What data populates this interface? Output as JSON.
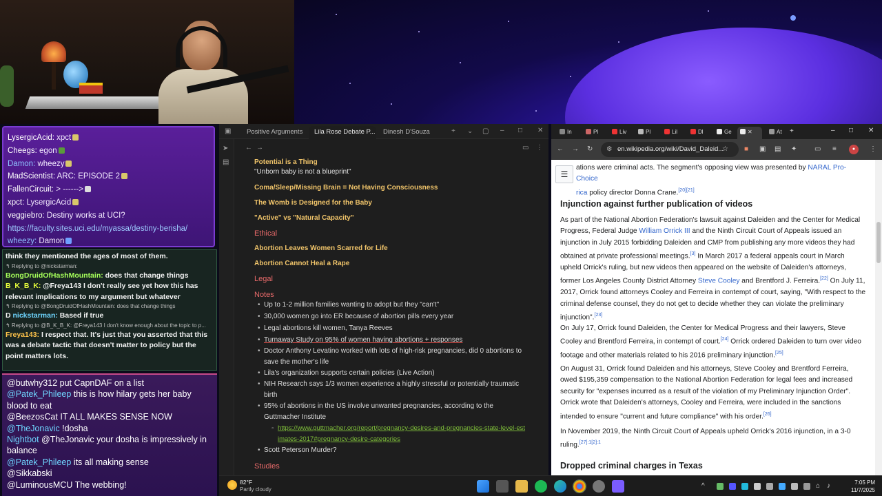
{
  "chat_top": [
    {
      "user": "LysergicAcid:",
      "text": " xpct",
      "blue": false
    },
    {
      "user": "Cheegs:",
      "text": " egon",
      "blue": false
    },
    {
      "user": "Damon:",
      "text": " wheezy",
      "blue": true
    },
    {
      "user": "MadScientist:",
      "text": " ARC: EPISODE 2",
      "blue": false
    },
    {
      "user": "FallenCircuit:",
      "text": " > ------>",
      "blue": false
    },
    {
      "user": "xpct:",
      "text": " LysergicAcid",
      "blue": false
    },
    {
      "user": "veggiebro:",
      "text": " Destiny works at UCI?",
      "blue": false
    },
    {
      "user": "",
      "text": "https://faculty.sites.uci.edu/myassa/destiny-berisha/",
      "blue": false,
      "link": true
    },
    {
      "user": "wheezy:",
      "text": " Damon",
      "blue": true
    }
  ],
  "chat_mid": {
    "l1": "think they mentioned the ages of most of them.",
    "r1": "↰ Replying to @nickstarman:",
    "l2_user": "BongDruidOfHashMountain:",
    "l2_text": " does that change things",
    "l3_user": "B_K_B_K:",
    "l3_text": " @Freya143 I don't really see yet how this has relevant implications to my argument but whatever",
    "r2": "↰ Replying to @BongDruidOfHashMountain: does that change things",
    "l4_prefix": "D",
    "l4_user": "nickstarman:",
    "l4_text": " Based if true",
    "r3": "↰ Replying to @B_K_B_K: @Freya143 I don't know enough about the topic to p...",
    "l5_user": "Freya143:",
    "l5_text": " I respect that. It's just that you asserted that this was a debate tactic that doesn't matter to policy but the point matters lots."
  },
  "chat_bot": [
    {
      "user": "@butwhy312",
      "text": " put CapnDAF on a list",
      "cyan": false
    },
    {
      "user": "@Patek_Phileep",
      "text": " this is how hilary gets her baby blood to eat",
      "cyan": true
    },
    {
      "user": "@BeezosCat",
      "text": " IT ALL MAKES SENSE NOW",
      "cyan": false
    },
    {
      "user": "@TheJonavic",
      "text": " !dosha",
      "cyan": true
    },
    {
      "user": "Nightbot",
      "text": " @TheJonavic your dosha is impressively in balance",
      "cyan": true
    },
    {
      "user": "@Patek_Phileep",
      "text": " its all making sense",
      "cyan": true
    },
    {
      "user": "@Sikkabski",
      "text": "",
      "cyan": false
    },
    {
      "user": "@LuminousMCU",
      "text": " The webbing!",
      "cyan": false
    }
  ],
  "obsidian": {
    "tabs": [
      "Positive Arguments",
      "Lila Rose Debate P...",
      "Dinesh D'Souza"
    ],
    "potential": "Potential is a Thing",
    "unborn": "\"Unborn baby is not a blueprint\"",
    "coma": "Coma/Sleep/Missing Brain = Not Having Consciousness",
    "womb": "The Womb is Designed for the Baby",
    "active": "\"Active\" vs \"Natural Capacity\"",
    "ethical": "Ethical",
    "scarred": "Abortion Leaves Women Scarred for Life",
    "rape": "Abortion Cannot Heal a Rape",
    "legal": "Legal",
    "notes": "Notes",
    "bullets": [
      "Up to 1-2 million families wanting to adopt but they \"can't\"",
      "30,000 women go into ER because of abortion pills every year",
      "Legal abortions kill women, Tanya Reeves",
      "Turnaway Study on 95% of women having abortions + responses",
      "Doctor Anthony Levatino worked with lots of high-risk pregnancies, did 0 abortions to save the mother's life",
      "Lila's organization supports certain policies (Live Action)",
      "NIH Research says 1/3 women experience a highly stressful or potentially traumatic birth",
      "95% of abortions in the US involve unwanted pregnancies, according to the Guttmacher Institute",
      "Scott Peterson Murder?"
    ],
    "sublink": "https://www.guttmacher.org/report/pregnancy-desires-and-pregnancies-state-level-estimates-2017#pregnancy-desire-categories",
    "studies": "Studies"
  },
  "chrome": {
    "tabs": [
      "In",
      "Pl",
      "Liv",
      "Pl",
      "Lil",
      "Dl",
      "Ge",
      "",
      "At"
    ],
    "url": "en.wikipedia.org/wiki/David_Daleid...",
    "top_text_a": "ations were criminal acts. The segment's opposing view was presented by ",
    "naral": "NARAL Pro-Choice",
    "top_text_b_link": "rica",
    "top_text_b": " policy director Donna Crane.",
    "top_refs": "[20][21]",
    "h_injunction": "Injunction against further publication of videos",
    "p1_a": "As part of the National Abortion Federation's lawsuit against Daleiden and the Center for Medical Progress, Federal Judge ",
    "p1_link": "William Orrick III",
    "p1_b": " and the Ninth Circuit Court of Appeals issued an injunction in July 2015 forbidding Daleiden and CMP from publishing any more videos they had obtained at private professional meetings.",
    "p1_ref1": "[3]",
    "p1_c": " In March 2017 a federal appeals court in March upheld Orrick's ruling, but new videos then appeared on the website of Daleiden's attorneys, former Los Angeles County District Attorney ",
    "p1_link2": "Steve Cooley",
    "p1_d": " and Brentford J. Ferreira.",
    "p1_ref2": "[22]",
    "p1_e": " On July 11, 2017, Orrick found attorneys Cooley and Ferreira in contempt of court, saying, \"With respect to the criminal defense counsel, they do not get to decide whether they can violate the preliminary injunction\".",
    "p1_ref3": "[23]",
    "p2_a": "On July 17, Orrick found Daleiden, the Center for Medical Progress and their lawyers, Steve Cooley and Brentford Ferreira, in contempt of court.",
    "p2_ref1": "[24]",
    "p2_b": " Orrick ordered Daleiden to turn over video footage and other materials related to his 2016 preliminary injunction.",
    "p2_ref2": "[25]",
    "p3_a": "On August 31, Orrick found Daleiden and his attorneys, Steve Cooley and Brentford Ferreira, owed $195,359 compensation to the National Abortion Federation for legal fees and increased security for \"expenses incurred as a result of the violation of my Preliminary Injunction Order\". Orrick wrote that Daleiden's attorneys, Cooley and Ferreira, were included in the sanctions intended to ensure \"current and future compliance\" with his order.",
    "p3_ref": "[26]",
    "p4_a": "In November 2019, the Ninth Circuit Court of Appeals upheld Orrick's 2016 injunction, in a 3-0 ruling.",
    "p4_ref": "[27]:1[2]:1",
    "h_dropped": "Dropped criminal charges in Texas"
  },
  "taskbar": {
    "temp": "82°F",
    "condition": "Partly cloudy",
    "time": "7:05 PM",
    "date": "11/7/2025"
  }
}
